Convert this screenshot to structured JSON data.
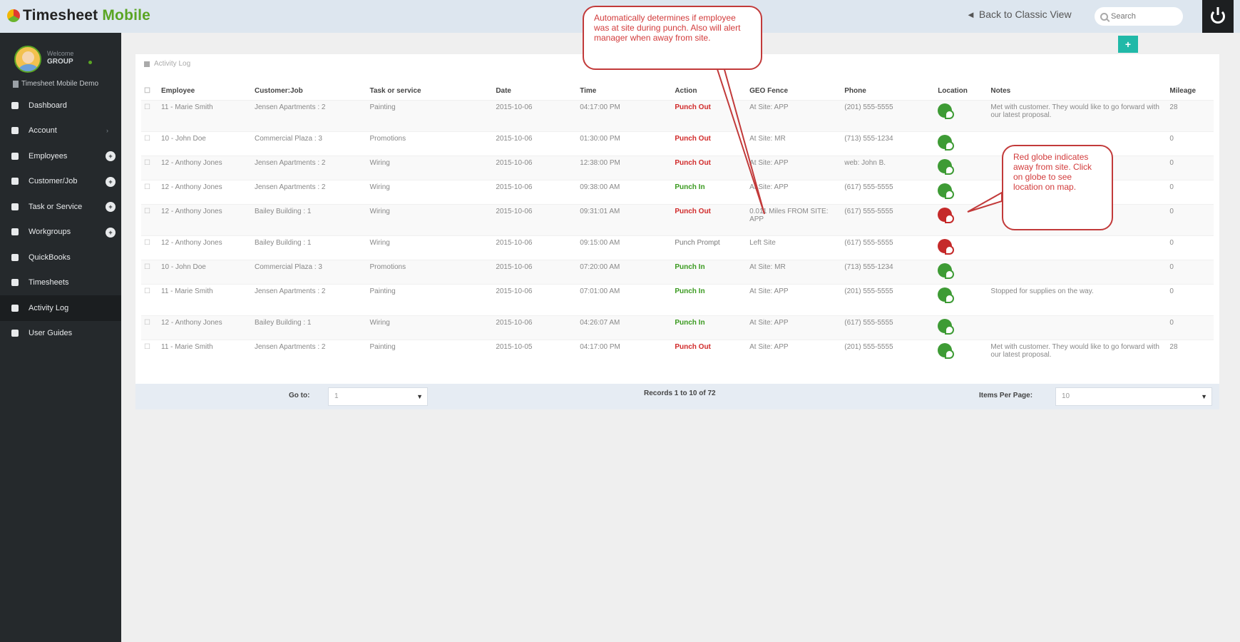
{
  "app": {
    "logo_text": "Timesheet",
    "logo_accent": "Mobile",
    "back_link": "Back to Classic View",
    "search_placeholder": "Search"
  },
  "sidebar": {
    "welcome": "Welcome",
    "username": "GROUP",
    "company": "Timesheet Mobile Demo",
    "items": [
      {
        "label": "Dashboard",
        "icon": "dashboard-icon"
      },
      {
        "label": "Account",
        "icon": "account-icon",
        "caret": "›"
      },
      {
        "label": "Employees",
        "icon": "employees-icon",
        "badge": "+"
      },
      {
        "label": "Customer/Job",
        "icon": "customer-job-icon",
        "badge": "+"
      },
      {
        "label": "Task or Service",
        "icon": "task-icon",
        "badge": "+"
      },
      {
        "label": "Workgroups",
        "icon": "workgroups-icon",
        "badge": "+"
      },
      {
        "label": "QuickBooks",
        "icon": "quickbooks-icon"
      },
      {
        "label": "Timesheets",
        "icon": "timesheets-icon"
      },
      {
        "label": "Activity Log",
        "icon": "activity-log-icon",
        "active": true
      },
      {
        "label": "User Guides",
        "icon": "user-guides-icon"
      }
    ]
  },
  "panel": {
    "title": "Activity Log",
    "add_button": "+"
  },
  "table": {
    "headers": [
      "Employee",
      "Customer:Job",
      "Task or service",
      "Date",
      "Time",
      "Action",
      "GEO Fence",
      "Phone",
      "Location",
      "Notes",
      "Mileage"
    ],
    "rows": [
      {
        "employee": "11 - Marie Smith",
        "job": "Jensen Apartments : 2",
        "task": "Painting",
        "date": "2015-10-06",
        "time": "04:17:00 PM",
        "action": "Punch Out",
        "action_type": "out",
        "geo": "At Site: APP",
        "phone": "(201) 555-5555",
        "globe": "green",
        "notes": "Met with customer. They would like to go forward with our latest proposal.",
        "mileage": "28"
      },
      {
        "employee": "10 - John Doe",
        "job": "Commercial Plaza : 3",
        "task": "Promotions",
        "date": "2015-10-06",
        "time": "01:30:00 PM",
        "action": "Punch Out",
        "action_type": "out",
        "geo": "At Site: MR",
        "phone": "(713) 555-1234",
        "globe": "green",
        "notes": "",
        "mileage": "0"
      },
      {
        "employee": "12 - Anthony Jones",
        "job": "Jensen Apartments : 2",
        "task": "Wiring",
        "date": "2015-10-06",
        "time": "12:38:00 PM",
        "action": "Punch Out",
        "action_type": "out",
        "geo": "At Site: APP",
        "phone": "web: John B.",
        "globe": "green",
        "notes": "",
        "mileage": "0"
      },
      {
        "employee": "12 - Anthony Jones",
        "job": "Jensen Apartments : 2",
        "task": "Wiring",
        "date": "2015-10-06",
        "time": "09:38:00 AM",
        "action": "Punch In",
        "action_type": "in",
        "geo": "At Site: APP",
        "phone": "(617) 555-5555",
        "globe": "green",
        "notes": "",
        "mileage": "0"
      },
      {
        "employee": "12 - Anthony Jones",
        "job": "Bailey Building : 1",
        "task": "Wiring",
        "date": "2015-10-06",
        "time": "09:31:01 AM",
        "action": "Punch Out",
        "action_type": "out",
        "geo": "0.011 Miles FROM SITE: APP",
        "phone": "(617) 555-5555",
        "globe": "red",
        "notes": "",
        "mileage": "0"
      },
      {
        "employee": "12 - Anthony Jones",
        "job": "Bailey Building : 1",
        "task": "Wiring",
        "date": "2015-10-06",
        "time": "09:15:00 AM",
        "action": "Punch Prompt",
        "action_type": "prompt",
        "geo": "Left Site",
        "phone": "(617) 555-5555",
        "globe": "red",
        "notes": "",
        "mileage": "0"
      },
      {
        "employee": "10 - John Doe",
        "job": "Commercial Plaza : 3",
        "task": "Promotions",
        "date": "2015-10-06",
        "time": "07:20:00 AM",
        "action": "Punch In",
        "action_type": "in",
        "geo": "At Site: MR",
        "phone": "(713) 555-1234",
        "globe": "green",
        "notes": "",
        "mileage": "0"
      },
      {
        "employee": "11 - Marie Smith",
        "job": "Jensen Apartments : 2",
        "task": "Painting",
        "date": "2015-10-06",
        "time": "07:01:00 AM",
        "action": "Punch In",
        "action_type": "in",
        "geo": "At Site: APP",
        "phone": "(201) 555-5555",
        "globe": "green",
        "notes": "Stopped for supplies on the way.",
        "mileage": "0"
      },
      {
        "employee": "12 - Anthony Jones",
        "job": "Bailey Building : 1",
        "task": "Wiring",
        "date": "2015-10-06",
        "time": "04:26:07 AM",
        "action": "Punch In",
        "action_type": "in",
        "geo": "At Site: APP",
        "phone": "(617) 555-5555",
        "globe": "green",
        "notes": "",
        "mileage": "0"
      },
      {
        "employee": "11 - Marie Smith",
        "job": "Jensen Apartments : 2",
        "task": "Painting",
        "date": "2015-10-05",
        "time": "04:17:00 PM",
        "action": "Punch Out",
        "action_type": "out",
        "geo": "At Site: APP",
        "phone": "(201) 555-5555",
        "globe": "green",
        "notes": "Met with customer. They would like to go forward with our latest proposal.",
        "mileage": "28"
      }
    ]
  },
  "pager": {
    "goto_label": "Go to:",
    "goto_value": "1",
    "records": "Records 1 to 10 of 72",
    "ipp_label": "Items Per Page:",
    "ipp_value": "10"
  },
  "callouts": {
    "geo": "Automatically determines if employee was at site during punch. Also will alert manager when away from site.",
    "globe": "Red globe indicates away from site. Click on globe to see location on map."
  },
  "colors": {
    "accent": "#21b9a8",
    "punch_out": "#d12a2a",
    "punch_in": "#3a9a1f",
    "sidebar": "#25292c"
  }
}
